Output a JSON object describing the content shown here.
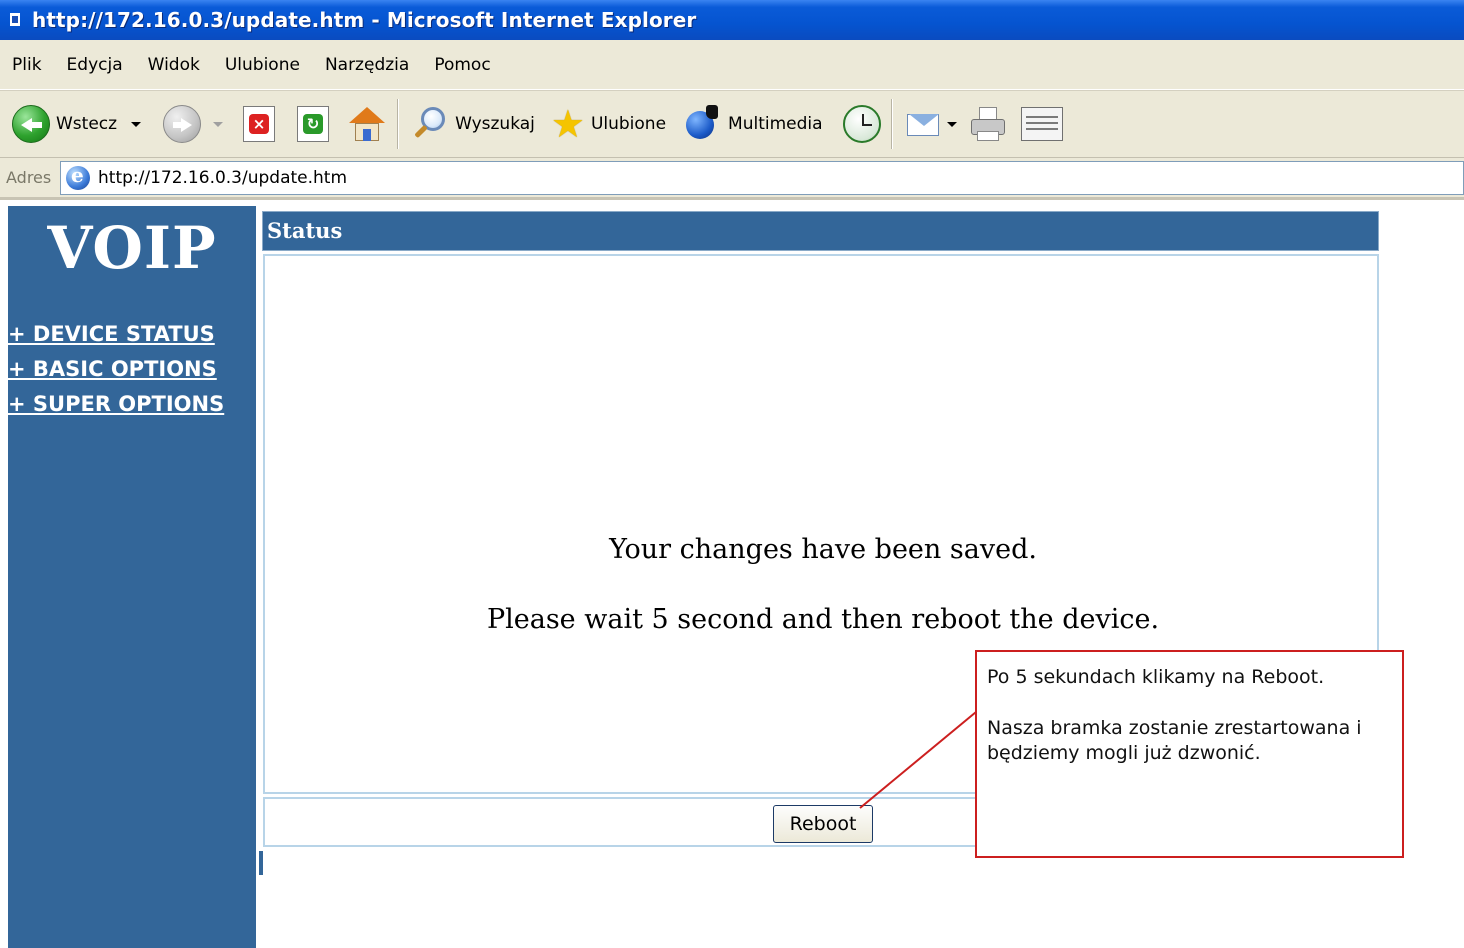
{
  "window": {
    "title": "http://172.16.0.3/update.htm - Microsoft Internet Explorer"
  },
  "menu": [
    "Plik",
    "Edycja",
    "Widok",
    "Ulubione",
    "Narzędzia",
    "Pomoc"
  ],
  "toolbar": {
    "back_label": "Wstecz",
    "search_label": "Wyszukaj",
    "favorites_label": "Ulubione",
    "media_label": "Multimedia"
  },
  "address": {
    "label": "Adres",
    "url": "http://172.16.0.3/update.htm"
  },
  "sidebar": {
    "logo": "VOIP",
    "links": [
      "+ DEVICE STATUS",
      "+ BASIC OPTIONS",
      "+ SUPER OPTIONS"
    ]
  },
  "main": {
    "header": "Status",
    "message1": "Your changes have been saved.",
    "message2": "Please wait 5 second and then reboot the device.",
    "reboot_label": "Reboot"
  },
  "callout": {
    "line1": "Po 5 sekundach klikamy na Reboot.",
    "line2": "Nasza bramka zostanie zrestartowana i będziemy mogli już dzwonić."
  },
  "colors": {
    "sidebar_blue": "#336699",
    "titlebar_blue": "#0554d0",
    "callout_red": "#cc1f1f"
  }
}
